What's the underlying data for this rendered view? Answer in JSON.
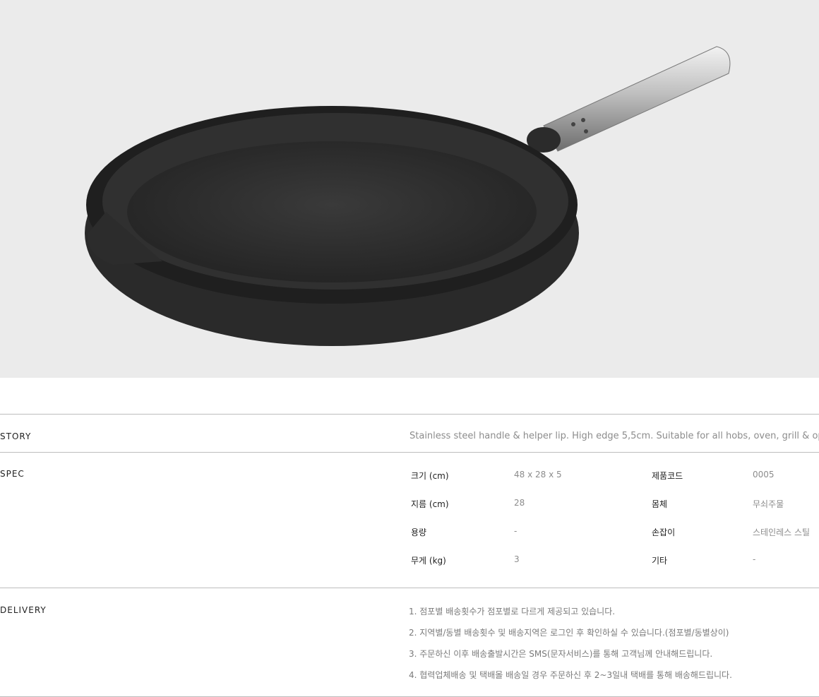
{
  "story": {
    "label": "STORY",
    "text": "Stainless steel handle & helper lip. High edge 5,5cm. Suitable for all hobs, oven, grill & open fire."
  },
  "spec": {
    "label": "SPEC",
    "rows": [
      {
        "k1": "크기 (cm)",
        "v1": "48 x 28 x 5",
        "k2": "제품코드",
        "v2": "0005"
      },
      {
        "k1": "지름 (cm)",
        "v1": "28",
        "k2": "몸체",
        "v2": "무쇠주물"
      },
      {
        "k1": "용량",
        "v1": "-",
        "k2": "손잡이",
        "v2": "스테인레스 스틸"
      },
      {
        "k1": "무게 (kg)",
        "v1": "3",
        "k2": "기타",
        "v2": "-"
      }
    ]
  },
  "delivery": {
    "label": "DELIVERY",
    "items": [
      "1. 점포별 배송횟수가 점포별로 다르게 제공되고 있습니다.",
      "2. 지역별/동별 배송횟수 및 배송지역은 로그인 후 확인하실 수 있습니다.(점포별/동별상이)",
      "3. 주문하신 이후 배송출발시간은 SMS(문자서비스)를 통해 고객님께 안내해드립니다.",
      "4. 협력업체배송 및 택배몰 배송일 경우 주문하신 후 2~3일내 택배를 통해 배송해드립니다."
    ]
  }
}
